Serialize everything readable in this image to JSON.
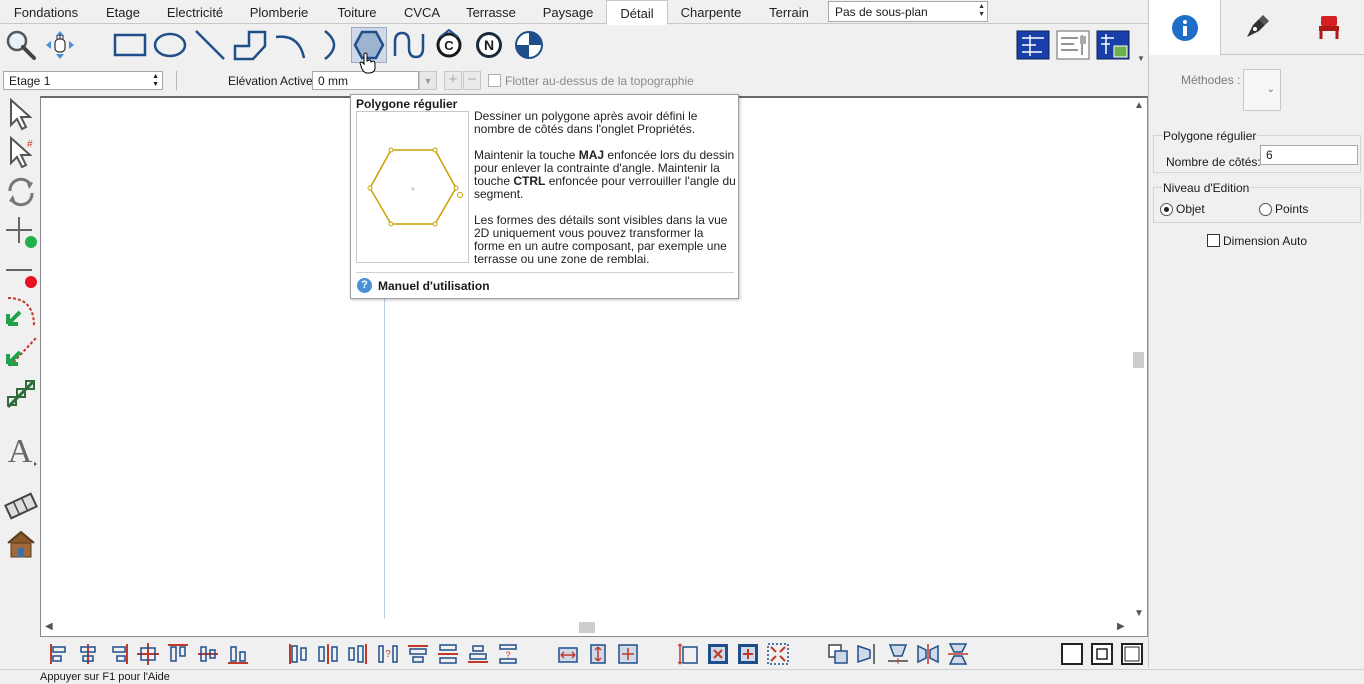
{
  "tabs": [
    {
      "label": "Fondations",
      "active": false
    },
    {
      "label": "Etage",
      "active": false
    },
    {
      "label": "Electricité",
      "active": false
    },
    {
      "label": "Plomberie",
      "active": false
    },
    {
      "label": "Toiture",
      "active": false
    },
    {
      "label": "CVCA",
      "active": false
    },
    {
      "label": "Terrasse",
      "active": false
    },
    {
      "label": "Paysage",
      "active": false
    },
    {
      "label": "Détail",
      "active": true
    },
    {
      "label": "Charpente",
      "active": false
    },
    {
      "label": "Terrain",
      "active": false
    }
  ],
  "subplan_select": {
    "value": "Pas de sous-plan"
  },
  "tools": [
    {
      "icon": "zoom-icon"
    },
    {
      "icon": "pan-hand-icon"
    },
    {
      "icon": "rectangle-icon"
    },
    {
      "icon": "circle-icon"
    },
    {
      "icon": "line-icon"
    },
    {
      "icon": "polyline-icon"
    },
    {
      "icon": "arc-icon"
    },
    {
      "icon": "half-arc-icon"
    },
    {
      "icon": "hexagon-icon",
      "active": true
    },
    {
      "icon": "wave-curve-icon"
    },
    {
      "icon": "copyright-symbol-icon"
    },
    {
      "icon": "north-arrow-icon"
    },
    {
      "icon": "target-marker-icon"
    }
  ],
  "view_buttons": [
    "plan-view-icon",
    "layout-view-icon",
    "render-view-icon"
  ],
  "options": {
    "floor_select": "Etage 1",
    "elevation_label": "Elévation Active:",
    "elevation_value": "0 mm",
    "float_label": "Flotter au-dessus de la topographie"
  },
  "left_tools": [
    "select-arrow-icon",
    "multi-select-arrow-icon",
    "rotate-icon",
    "add-point-icon",
    "delete-point-icon",
    "trim-arc-icon",
    "trim-line-icon",
    "chain-link-icon",
    "text-icon",
    "film-strip-icon",
    "house-icon"
  ],
  "tooltip": {
    "title": "Polygone régulier",
    "para1": "Dessiner un polygone après avoir défini le nombre de côtés dans l'onglet Propriétés.",
    "para2_pre": "Maintenir la touche ",
    "para2_key1": "MAJ",
    "para2_mid": " enfoncée lors du dessin pour enlever la contrainte d'angle. Maintenir la touche ",
    "para2_key2": "CTRL",
    "para2_post": " enfoncée pour verrouiller l'angle du segment.",
    "para3": "Les formes des détails sont visibles dans la vue 2D uniquement vous pouvez transformer la forme en un autre composant, par exemple une terrasse ou une zone de remblai.",
    "manual_label": "Manuel d'utilisation"
  },
  "right_panel": {
    "tabs": [
      "info-icon",
      "pen-nib-icon",
      "chair-icon"
    ],
    "methodes_label": "Méthodes :",
    "polygon_group_title": "Polygone régulier",
    "sides_label": "Nombre de côtés:",
    "sides_value": "6",
    "edit_level_title": "Niveau d'Edition",
    "radio_object": "Objet",
    "radio_points": "Points",
    "dimension_auto": "Dimension Auto"
  },
  "status": {
    "text": "Appuyer sur F1 pour l'Aide"
  },
  "colors": {
    "accent": "#1f5fa8",
    "active_tab_bg": "#ffffff",
    "tool_active_bg": "#cfd9e8",
    "polygon_stroke": "#c8a000"
  }
}
